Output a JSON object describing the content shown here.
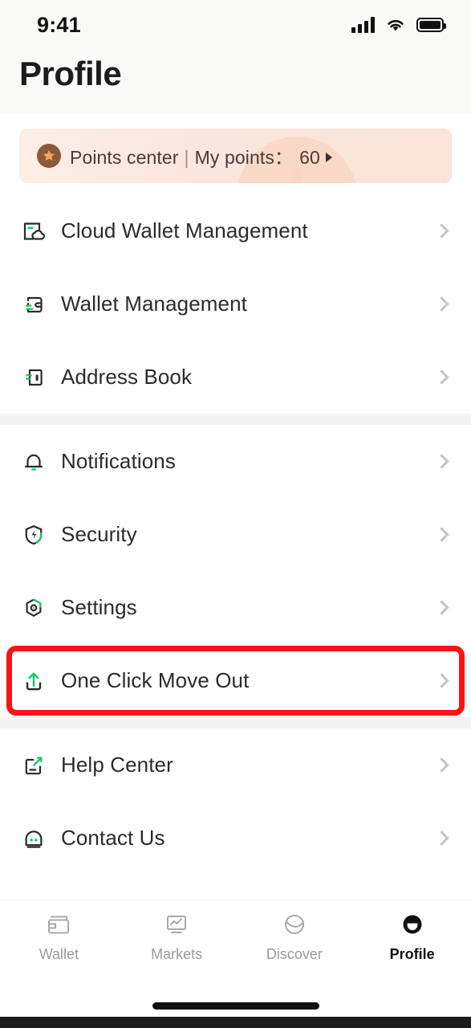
{
  "status_bar": {
    "time": "9:41",
    "signal_icon": "cellular-signal-icon",
    "wifi_icon": "wifi-icon",
    "battery_icon": "battery-icon"
  },
  "header": {
    "title": "Profile"
  },
  "points_banner": {
    "icon": "star-badge-icon",
    "label": "Points center",
    "separator": "|",
    "points_label": "My points：",
    "points_value": "60",
    "caret_icon": "caret-right-icon"
  },
  "sections": [
    {
      "items": [
        {
          "label": "Cloud Wallet Management",
          "icon": "cloud-wallet-icon",
          "chevron": "chevron-right-icon",
          "highlighted": false
        },
        {
          "label": "Wallet Management",
          "icon": "wallet-icon",
          "chevron": "chevron-right-icon",
          "highlighted": false
        },
        {
          "label": "Address Book",
          "icon": "address-book-icon",
          "chevron": "chevron-right-icon",
          "highlighted": false
        }
      ]
    },
    {
      "items": [
        {
          "label": "Notifications",
          "icon": "bell-icon",
          "chevron": "chevron-right-icon",
          "highlighted": false
        },
        {
          "label": "Security",
          "icon": "shield-bolt-icon",
          "chevron": "chevron-right-icon",
          "highlighted": false
        },
        {
          "label": "Settings",
          "icon": "gear-icon",
          "chevron": "chevron-right-icon",
          "highlighted": false
        },
        {
          "label": "One Click Move Out",
          "icon": "upload-icon",
          "chevron": "chevron-right-icon",
          "highlighted": true
        }
      ]
    },
    {
      "items": [
        {
          "label": "Help Center",
          "icon": "edit-square-icon",
          "chevron": "chevron-right-icon",
          "highlighted": false
        },
        {
          "label": "Contact Us",
          "icon": "chat-bot-icon",
          "chevron": "chevron-right-icon",
          "highlighted": false
        }
      ]
    }
  ],
  "tabbar": {
    "tabs": [
      {
        "label": "Wallet",
        "icon": "wallet-tab-icon",
        "active": false
      },
      {
        "label": "Markets",
        "icon": "markets-chart-icon",
        "active": false
      },
      {
        "label": "Discover",
        "icon": "discover-globe-icon",
        "active": false
      },
      {
        "label": "Profile",
        "icon": "profile-avatar-icon",
        "active": true
      }
    ]
  },
  "colors": {
    "accent_green": "#14c964",
    "highlight_red": "#fa1414",
    "text_primary": "#2b2b2e",
    "text_muted": "#9b9b9f",
    "banner_bg": "#fbe6dd"
  }
}
